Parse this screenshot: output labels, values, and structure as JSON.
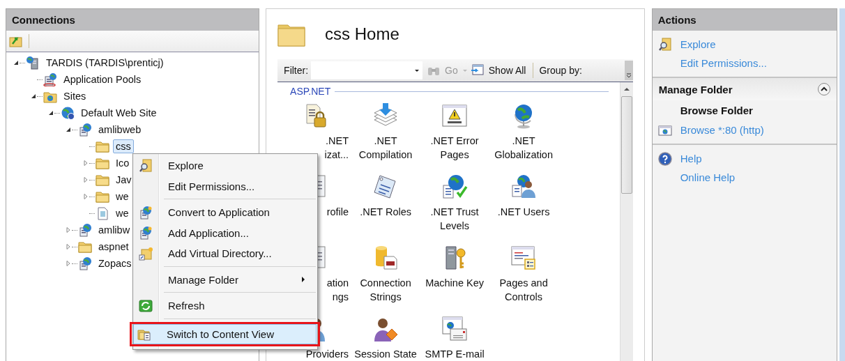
{
  "connections": {
    "title": "Connections",
    "tree": [
      {
        "label": "TARDIS (TARDIS\\prenticj)",
        "kind": "server",
        "expandable": true,
        "expanded": true,
        "selected": false,
        "children": [
          {
            "label": "Application Pools",
            "kind": "pool",
            "expandable": false,
            "selected": false
          },
          {
            "label": "Sites",
            "kind": "sites",
            "expandable": true,
            "expanded": true,
            "selected": false,
            "children": [
              {
                "label": "Default Web Site",
                "kind": "site",
                "expandable": true,
                "expanded": true,
                "selected": false,
                "children": [
                  {
                    "label": "amlibweb",
                    "kind": "app",
                    "expandable": true,
                    "expanded": true,
                    "selected": false,
                    "children": [
                      {
                        "label": "css",
                        "kind": "folder",
                        "expandable": false,
                        "selected": true
                      },
                      {
                        "label": "Ico",
                        "kind": "folder",
                        "expandable": true,
                        "expanded": false,
                        "selected": false
                      },
                      {
                        "label": "Jav",
                        "kind": "folder",
                        "expandable": true,
                        "expanded": false,
                        "selected": false
                      },
                      {
                        "label": "we",
                        "kind": "folder",
                        "expandable": true,
                        "expanded": false,
                        "selected": false
                      },
                      {
                        "label": "we",
                        "kind": "file",
                        "expandable": false,
                        "selected": false
                      }
                    ]
                  },
                  {
                    "label": "amlibw",
                    "kind": "app",
                    "expandable": true,
                    "expanded": false,
                    "selected": false
                  },
                  {
                    "label": "aspnet",
                    "kind": "folder",
                    "expandable": true,
                    "expanded": false,
                    "selected": false
                  },
                  {
                    "label": "Zopacs",
                    "kind": "app",
                    "expandable": true,
                    "expanded": false,
                    "selected": false
                  }
                ]
              }
            ]
          }
        ]
      }
    ]
  },
  "context_menu": {
    "items": [
      {
        "kind": "item",
        "label": "Explore",
        "submenu": false,
        "selected": false,
        "annotated": false
      },
      {
        "kind": "item",
        "label": "Edit Permissions...",
        "submenu": false,
        "selected": false,
        "annotated": false
      },
      {
        "kind": "separator"
      },
      {
        "kind": "item",
        "label": "Convert to Application",
        "submenu": false,
        "selected": false,
        "annotated": false
      },
      {
        "kind": "item",
        "label": "Add Application...",
        "submenu": false,
        "selected": false,
        "annotated": false
      },
      {
        "kind": "item",
        "label": "Add Virtual Directory...",
        "submenu": false,
        "selected": false,
        "annotated": false
      },
      {
        "kind": "separator"
      },
      {
        "kind": "item",
        "label": "Manage Folder",
        "submenu": true,
        "selected": false,
        "annotated": false
      },
      {
        "kind": "separator"
      },
      {
        "kind": "item",
        "label": "Refresh",
        "submenu": false,
        "selected": false,
        "annotated": false
      },
      {
        "kind": "separator"
      },
      {
        "kind": "item",
        "label": "Switch to Content View",
        "submenu": false,
        "selected": true,
        "annotated": true
      }
    ]
  },
  "home": {
    "title": "css Home",
    "filter": {
      "label": "Filter:",
      "go": "Go",
      "show_all": "Show All",
      "group_by": "Group by:"
    },
    "group": "ASP.NET",
    "features": [
      {
        "lines": [
          ".NET",
          "izat..."
        ]
      },
      {
        "lines": [
          ".NET",
          "Compilation"
        ]
      },
      {
        "lines": [
          ".NET Error",
          "Pages"
        ]
      },
      {
        "lines": [
          ".NET",
          "Globalization"
        ]
      },
      {
        "lines": [
          "rofile"
        ]
      },
      {
        "lines": [
          ".NET Roles"
        ]
      },
      {
        "lines": [
          ".NET Trust",
          "Levels"
        ]
      },
      {
        "lines": [
          ".NET Users"
        ]
      },
      {
        "lines": [
          "ation",
          "ngs"
        ]
      },
      {
        "lines": [
          "Connection",
          "Strings"
        ]
      },
      {
        "lines": [
          "Machine Key"
        ]
      },
      {
        "lines": [
          "Pages and",
          "Controls"
        ]
      },
      {
        "lines": [
          "Providers"
        ]
      },
      {
        "lines": [
          "Session State"
        ]
      },
      {
        "lines": [
          "SMTP E-mail"
        ]
      }
    ]
  },
  "actions": {
    "title": "Actions",
    "sections": [
      {
        "kind": "links",
        "items": [
          "Explore",
          "Edit Permissions..."
        ]
      },
      {
        "kind": "group",
        "title": "Manage Folder",
        "expanded": true
      },
      {
        "kind": "heading",
        "title": "Browse Folder"
      },
      {
        "kind": "links",
        "items": [
          "Browse *:80 (http)"
        ]
      },
      {
        "kind": "links",
        "items": [
          "Help",
          "Online Help"
        ]
      }
    ]
  }
}
